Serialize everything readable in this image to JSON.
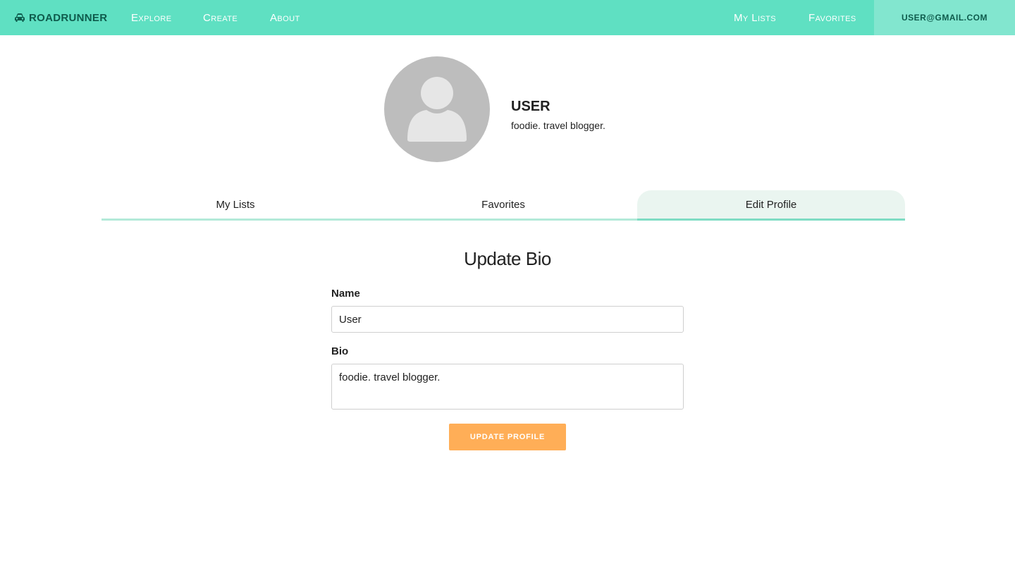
{
  "nav": {
    "brand": "ROADRUNNER",
    "brand_icon": "car-icon",
    "links": [
      "Explore",
      "Create",
      "About"
    ],
    "right_links": [
      "My Lists",
      "Favorites"
    ],
    "user_email": "user@gmail.com"
  },
  "profile": {
    "avatar_icon": "user-silhouette-icon",
    "name": "USER",
    "bio": "foodie. travel blogger."
  },
  "tabs": [
    {
      "label": "My Lists",
      "active": false
    },
    {
      "label": "Favorites",
      "active": false
    },
    {
      "label": "Edit Profile",
      "active": true
    }
  ],
  "form": {
    "title": "Update Bio",
    "name_label": "Name",
    "name_value": "User",
    "bio_label": "Bio",
    "bio_value": "foodie. travel blogger.",
    "submit_label": "Update Profile"
  },
  "colors": {
    "navbar": "#5fe0c2",
    "navbar_user": "#82e6cf",
    "accent_dark": "#0e5b4c",
    "tab_active_bg": "#eaf5f0",
    "button": "#ffae57"
  }
}
